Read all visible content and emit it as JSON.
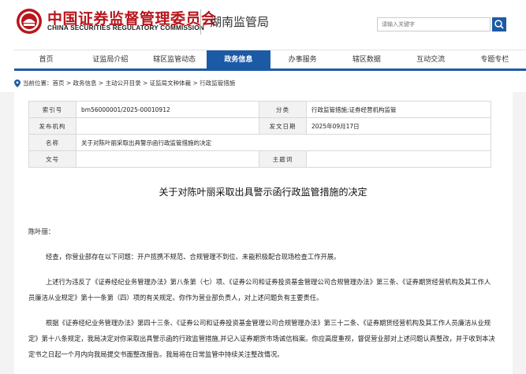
{
  "header": {
    "title_cn": "中国证券监督管理委员会",
    "title_en": "CHINA SECURITIES REGULATORY COMMISSION",
    "subtitle": "湖南监管局",
    "search_placeholder": "请输入关键字",
    "colors": {
      "brand_red": "#b8161c",
      "accent_blue": "#1d5aa5"
    }
  },
  "nav": {
    "items": [
      "首页",
      "证监局介绍",
      "辖区监管动态",
      "政务信息",
      "办事服务",
      "辖区数据",
      "互动交流",
      "专题专栏"
    ],
    "active_index": 3
  },
  "breadcrumb": {
    "prefix": "当前位置：",
    "path": "首页 > 政务信息 > 主动公开目录 > 证监局文种体裁 > 行政监管措施"
  },
  "info": {
    "index_label": "索引号",
    "index_value": "bm56000001/2025-00010912",
    "category_label": "分类",
    "category_value": "行政监管措施;证券经营机构监管",
    "issuer_label": "发布机构",
    "issuer_value": "",
    "date_label": "发文日期",
    "date_value": "2025年09月17日",
    "name_label": "名称",
    "name_value": "关于对陈叶丽采取出具警示函行政监管措施的决定",
    "docno_label": "文号",
    "docno_value": "",
    "keywords_label": "主题词",
    "keywords_value": ""
  },
  "document": {
    "title": "关于对陈叶丽采取出具警示函行政监管措施的决定",
    "salutation": "陈叶丽：",
    "paragraphs": [
      "经查，你营业部存在以下问题：开户揽携不规范、合规管理不到位、未能积极配合现场检查工作开展。",
      "上述行为违反了《证券经纪业务管理办法》第八条第（七）项、《证券公司和证券投资基金管理公司合规管理办法》第三条、《证券期货经营机构及其工作人员廉洁从业规定》第十一条第（四）项的有关规定。你作为营业部负责人，对上述问题负有主要责任。",
      "根据《证券经纪业务管理办法》第四十三条、《证券公司和证券投资基金管理公司合规管理办法》第三十二条、《证券期货经营机构及其工作人员廉洁从业规定》第十八条规定，我局决定对你采取出具警示函的行政监管措施,并记入证券期货市场诚信档案。你应高度重视，督促营业部对上述问题认真整改，并于收到本决定书之日起一个月内向我局提交书面整改报告。我局将在日常监管中持续关注整改情况。"
    ]
  }
}
